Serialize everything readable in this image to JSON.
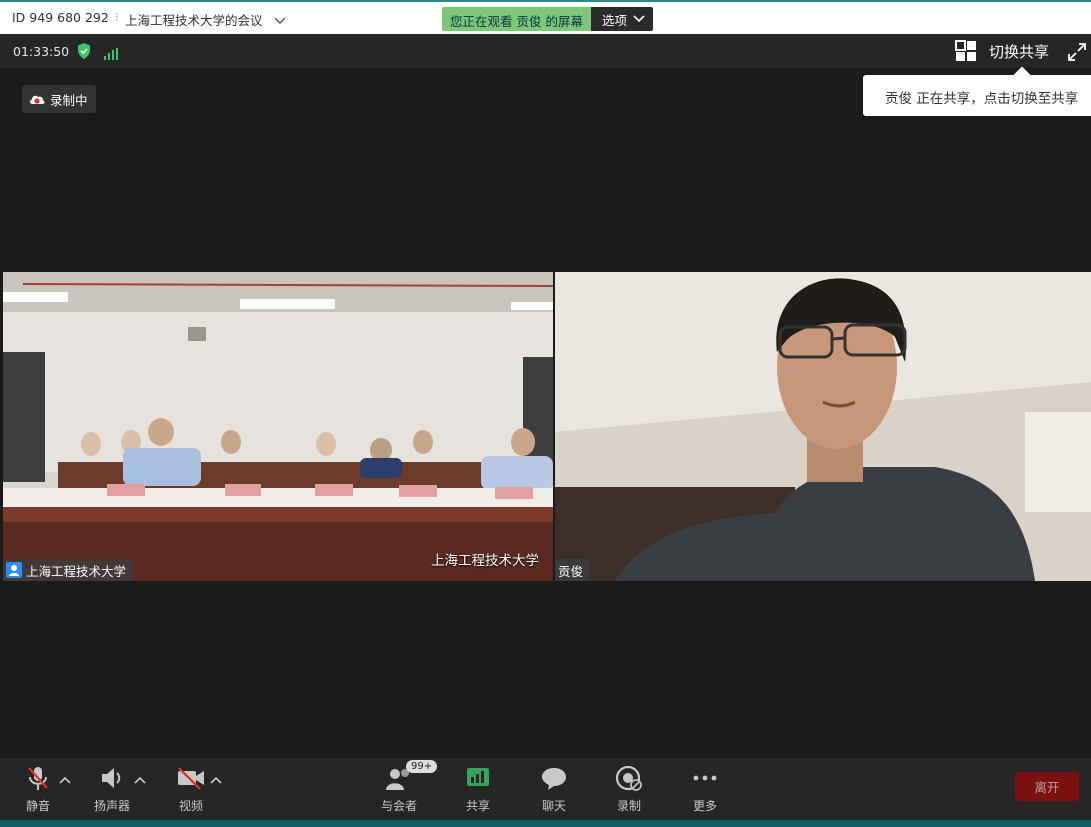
{
  "titlebar": {
    "meeting_id": "ID 949 680 292",
    "separator": "⁝",
    "meeting_title": "上海工程技术大学的会议",
    "viewing_text": "您正在观看 贡俊 的屏幕",
    "options_label": "选项"
  },
  "topbar": {
    "timer": "01:33:50",
    "switch_share_label": "切换共享"
  },
  "stage": {
    "recording_label": "录制中",
    "tooltip_text": "贡俊 正在共享，点击切换至共享"
  },
  "videos": [
    {
      "name": "上海工程技术大学",
      "watermark": "上海工程技术大学"
    },
    {
      "name": "贡俊"
    }
  ],
  "toolbar": {
    "mute_label": "静音",
    "speaker_label": "扬声器",
    "video_label": "视频",
    "participants_label": "与会者",
    "participants_badge": "99+",
    "share_label": "共享",
    "chat_label": "聊天",
    "record_label": "录制",
    "more_label": "更多",
    "leave_label": "离开"
  },
  "colors": {
    "accent": "#7cc878",
    "shield": "#3ec46d",
    "leave": "#7a1010",
    "bar": "#262626",
    "stage": "#1b1b1b"
  },
  "icons": [
    "shield-icon",
    "signal-icon",
    "switch-share-icon",
    "fullscreen-icon",
    "cloud-record-icon",
    "user-icon",
    "mic-muted-icon",
    "speaker-icon",
    "camera-off-icon",
    "participants-icon",
    "share-screen-icon",
    "chat-icon",
    "record-icon",
    "more-icon"
  ]
}
